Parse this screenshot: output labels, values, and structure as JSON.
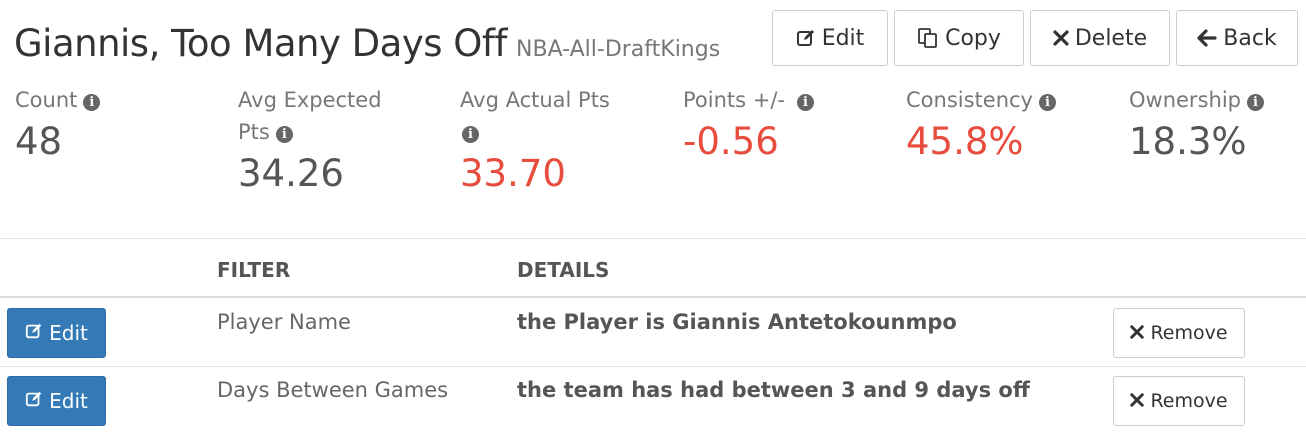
{
  "header": {
    "title": "Giannis, Too Many Days Off",
    "subtitle": "NBA-All-DraftKings"
  },
  "toolbar": {
    "edit_label": "Edit",
    "copy_label": "Copy",
    "delete_label": "Delete",
    "back_label": "Back"
  },
  "stats": [
    {
      "label": "Count",
      "value": "48",
      "negative": false
    },
    {
      "label_line1": "Avg Expected",
      "label_line2": "Pts",
      "value": "34.26",
      "negative": false
    },
    {
      "label": "Avg Actual Pts",
      "value": "33.70",
      "negative": true
    },
    {
      "label": "Points +/-",
      "value": "-0.56",
      "negative": true
    },
    {
      "label": "Consistency",
      "value": "45.8%",
      "negative": true
    },
    {
      "label": "Ownership",
      "value": "18.3%",
      "negative": false
    }
  ],
  "table": {
    "columns": [
      "FILTER",
      "DETAILS"
    ],
    "rows": [
      {
        "edit_label": "Edit",
        "filter": "Player Name",
        "details": "the Player is Giannis Antetokounmpo",
        "remove_label": "Remove"
      },
      {
        "edit_label": "Edit",
        "filter": "Days Between Games",
        "details": "the team has had between 3 and 9 days off",
        "remove_label": "Remove"
      }
    ]
  },
  "colors": {
    "negative": "#e74c3c",
    "primary": "#337ab7"
  },
  "icons": {
    "edit": "pencil-square-icon",
    "copy": "copy-icon",
    "delete": "close-icon",
    "back": "arrow-left-icon",
    "info": "info-circle-icon"
  }
}
